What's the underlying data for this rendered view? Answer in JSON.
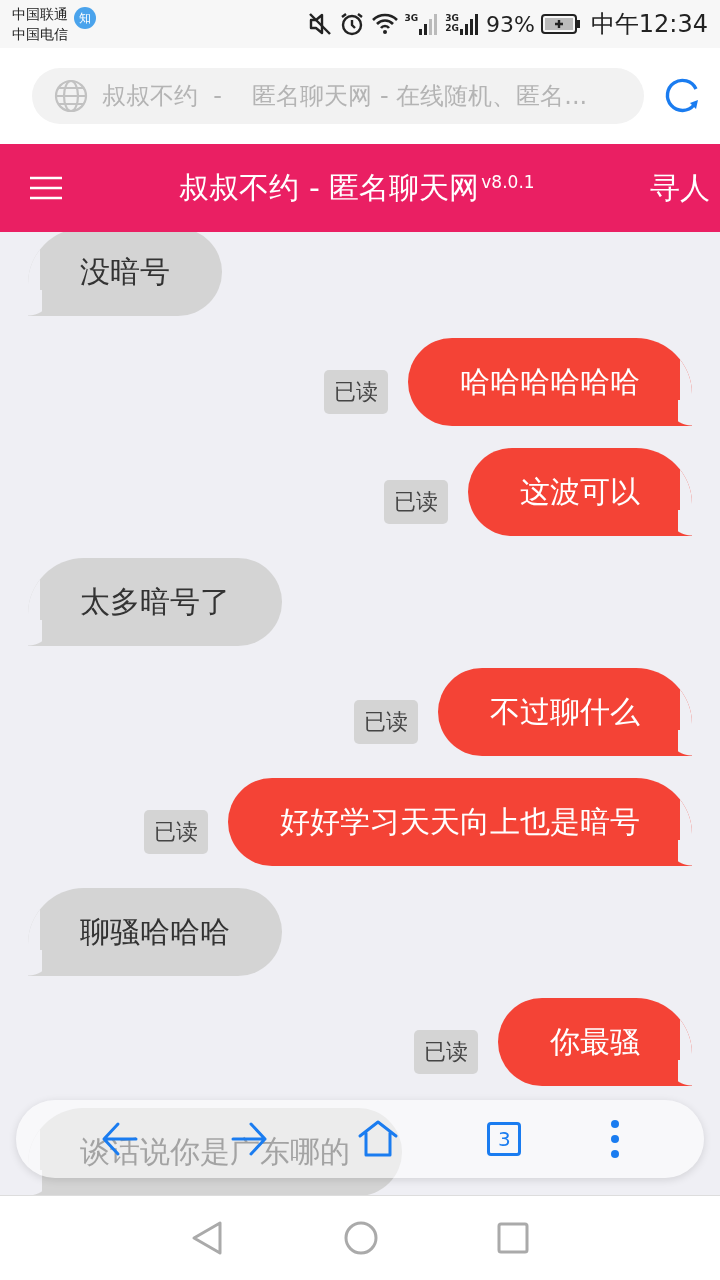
{
  "status_bar": {
    "carriers": [
      "中国联通",
      "中国电信"
    ],
    "notification_badge": "知",
    "signal_1_label": "3G",
    "signal_2_labels": [
      "3G",
      "2G"
    ],
    "battery": "93%",
    "time": "中午12:34"
  },
  "address_bar": {
    "title": "叔叔不约  -    匿名聊天网 - 在线随机、匿名..."
  },
  "header": {
    "title": "叔叔不约 - 匿名聊天网",
    "version": "v8.0.1",
    "action": "寻人"
  },
  "messages": [
    {
      "kind": "received",
      "text": "没暗号"
    },
    {
      "kind": "sent",
      "text": "哈哈哈哈哈哈",
      "read_label": "已读"
    },
    {
      "kind": "sent",
      "text": "这波可以",
      "read_label": "已读"
    },
    {
      "kind": "received",
      "text": "太多暗号了"
    },
    {
      "kind": "sent",
      "text": "不过聊什么",
      "read_label": "已读"
    },
    {
      "kind": "sent",
      "text": "好好学习天天向上也是暗号",
      "read_label": "已读"
    },
    {
      "kind": "received",
      "text": "聊骚哈哈哈"
    },
    {
      "kind": "sent",
      "text": "你最骚",
      "read_label": "已读"
    },
    {
      "kind": "received",
      "text": "谈话说你是广东哪的"
    }
  ],
  "toolbar": {
    "tab_count": "3"
  }
}
